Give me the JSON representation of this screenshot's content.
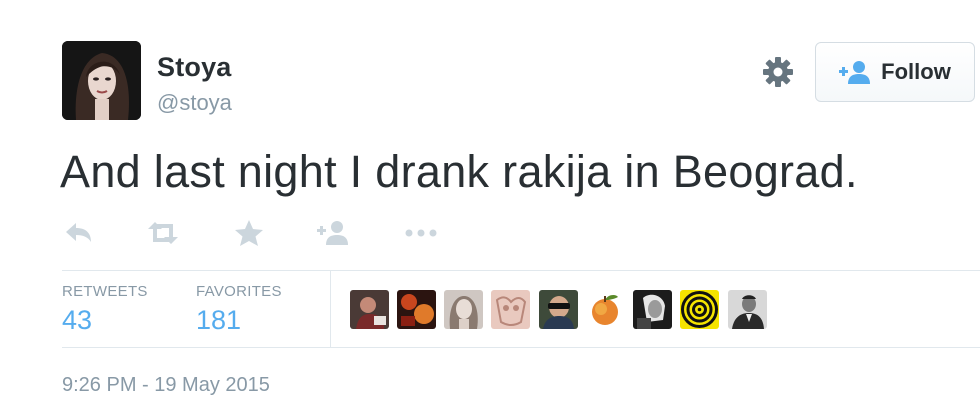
{
  "author": {
    "display_name": "Stoya",
    "screen_name": "@stoya"
  },
  "follow_button": {
    "label": "Follow"
  },
  "tweet": {
    "text": "And last night I drank rakija in Beograd.",
    "timestamp": "9:26 PM - 19 May 2015"
  },
  "actions": [
    "reply-icon",
    "retweet-icon",
    "favorite-icon",
    "follow-icon",
    "more-icon"
  ],
  "stats": {
    "retweets": {
      "label": "RETWEETS",
      "value": "43"
    },
    "favorites": {
      "label": "FAVORITES",
      "value": "181"
    }
  },
  "favoriter_avatars_count": 9,
  "colors": {
    "text": "#292f33",
    "muted": "#8899a6",
    "accent": "#55acee",
    "divider": "#e1e8ed"
  }
}
